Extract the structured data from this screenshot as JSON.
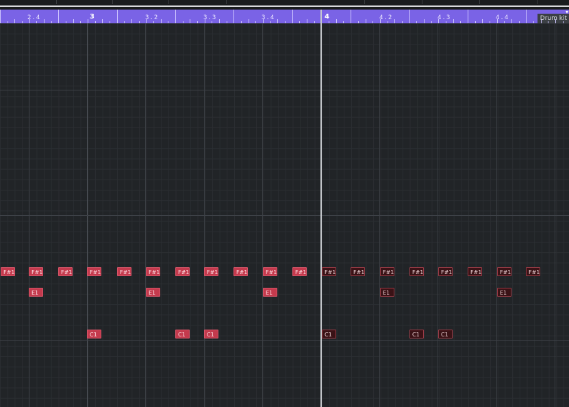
{
  "ruler": {
    "labels": [
      {
        "text": "2.4",
        "pos_label": "2.4",
        "kind": "sub"
      },
      {
        "text": "3",
        "kind": "bar"
      },
      {
        "text": "3.2",
        "kind": "sub"
      },
      {
        "text": "3.3",
        "kind": "sub"
      },
      {
        "text": "3.4",
        "kind": "sub"
      },
      {
        "text": "4",
        "kind": "bar"
      },
      {
        "text": "4.2",
        "kind": "sub"
      },
      {
        "text": "4.3",
        "kind": "sub"
      },
      {
        "text": "4.4",
        "kind": "sub"
      }
    ],
    "track_tag": "Drum kit"
  },
  "notes": {
    "fsharp": "F#1",
    "e": "E1",
    "c": "C1"
  },
  "colors": {
    "ruler": "#7a63e6",
    "note_selected": "#c43a4d",
    "note_dark": "#3a1216",
    "grid_bg": "#212427"
  }
}
